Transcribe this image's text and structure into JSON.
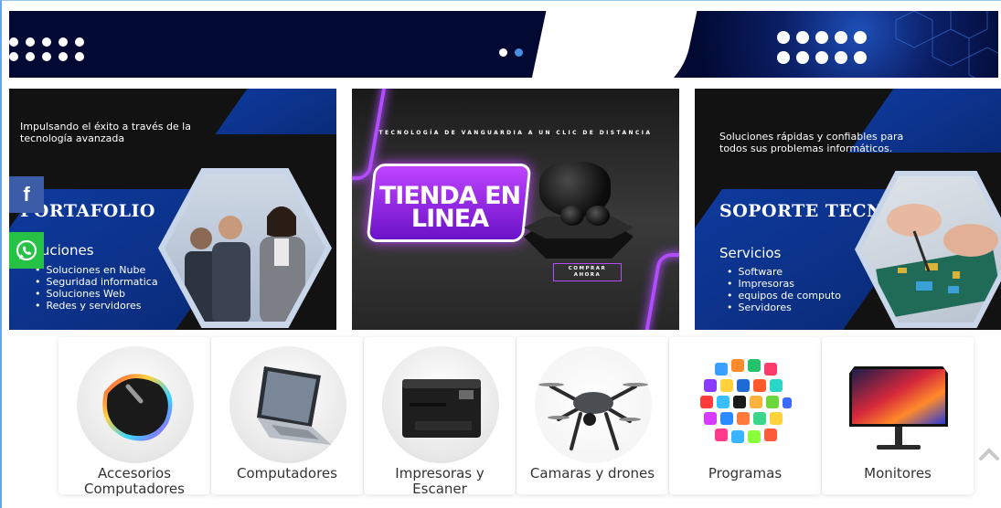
{
  "colors": {
    "hero_bg": "#020a33",
    "slider_dot_active": "#ffffff",
    "slider_dot_inactive": "#4a90e2",
    "facebook": "#3b5ca7",
    "whatsapp": "#25c246",
    "neon": "#b14dff",
    "banner_blue": "#0e3a9c"
  },
  "social": {
    "facebook_glyph": "f"
  },
  "banners": {
    "portafolio": {
      "tagline_line1": "Impulsando el éxito a través de la",
      "tagline_line2": "tecnología avanzada",
      "heading": "PORTAFOLIO",
      "subheading": "Soluciones",
      "items": [
        "Soluciones en Nube",
        "Seguridad informatica",
        "Soluciones Web",
        "Redes y servidores"
      ]
    },
    "tienda": {
      "top_text": "TECNOLOGÍA DE VANGUARDIA A UN CLIC DE DISTANCIA",
      "title_line1": "TIENDA EN",
      "title_line2": "LINEA",
      "button_line1": "COMPRAR",
      "button_line2": "AHORA"
    },
    "soporte": {
      "tagline_line1": "Soluciones rápidas y confiables para",
      "tagline_line2": "todos sus problemas informáticos.",
      "heading": "SOPORTE TECNICO",
      "subheading": "Servicios",
      "items": [
        "Software",
        "Impresoras",
        "equipos de computo",
        "Servidores"
      ]
    }
  },
  "categories": [
    {
      "line1": "Accesorios",
      "line2": "Computadores",
      "icon": "gaming-mouse"
    },
    {
      "line1": "Computadores",
      "line2": "",
      "icon": "laptop"
    },
    {
      "line1": "Impresoras y",
      "line2": "Escaner",
      "icon": "printer"
    },
    {
      "line1": "Camaras y drones",
      "line2": "",
      "icon": "drone"
    },
    {
      "line1": "Programas",
      "line2": "",
      "icon": "app-icons-sphere"
    },
    {
      "line1": "Monitores",
      "line2": "",
      "icon": "monitor"
    }
  ]
}
